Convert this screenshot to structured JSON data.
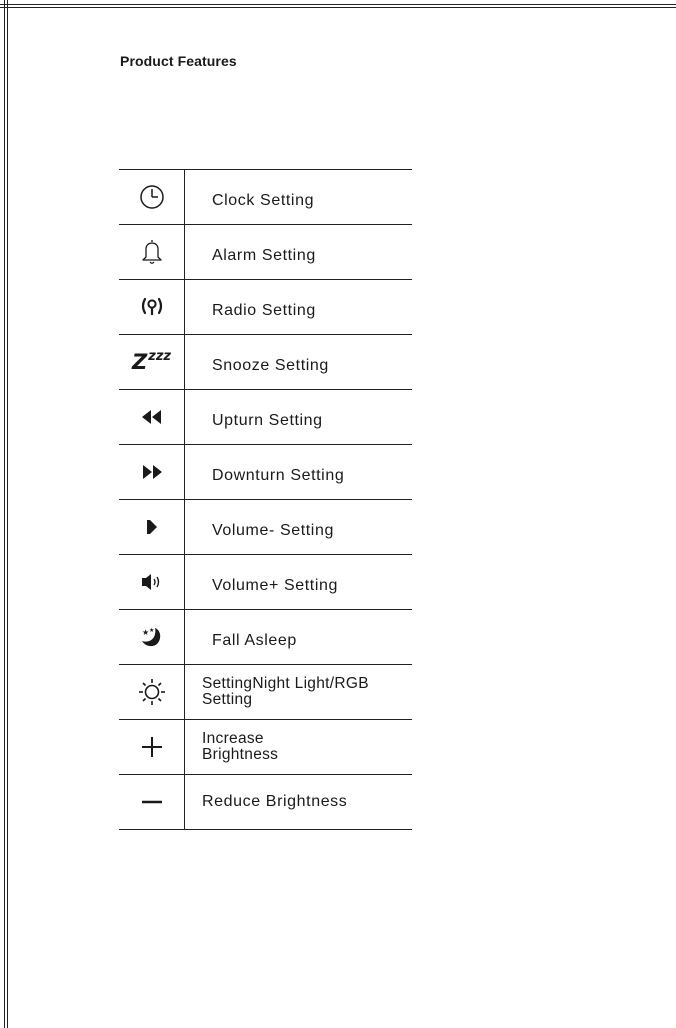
{
  "title": "Product Features",
  "features": [
    {
      "icon": "clock-icon",
      "label": "Clock Setting"
    },
    {
      "icon": "bell-icon",
      "label": "Alarm Setting"
    },
    {
      "icon": "radio-icon",
      "label": "Radio Setting"
    },
    {
      "icon": "snooze-icon",
      "label": "Snooze Setting"
    },
    {
      "icon": "rewind-icon",
      "label": "Upturn Setting"
    },
    {
      "icon": "fast-forward-icon",
      "label": "Downturn Setting"
    },
    {
      "icon": "volume-down-icon",
      "label": "Volume- Setting"
    },
    {
      "icon": "volume-up-icon",
      "label": "Volume+ Setting"
    },
    {
      "icon": "moon-stars-icon",
      "label": "Fall Asleep"
    },
    {
      "icon": "sun-icon",
      "label": "SettingNight Light/RGB\nSetting"
    },
    {
      "icon": "plus-icon",
      "label": "Increase\nBrightness"
    },
    {
      "icon": "minus-icon",
      "label": "Reduce Brightness"
    }
  ],
  "snooze_glyph": {
    "big": "Z",
    "small": "zzz"
  }
}
